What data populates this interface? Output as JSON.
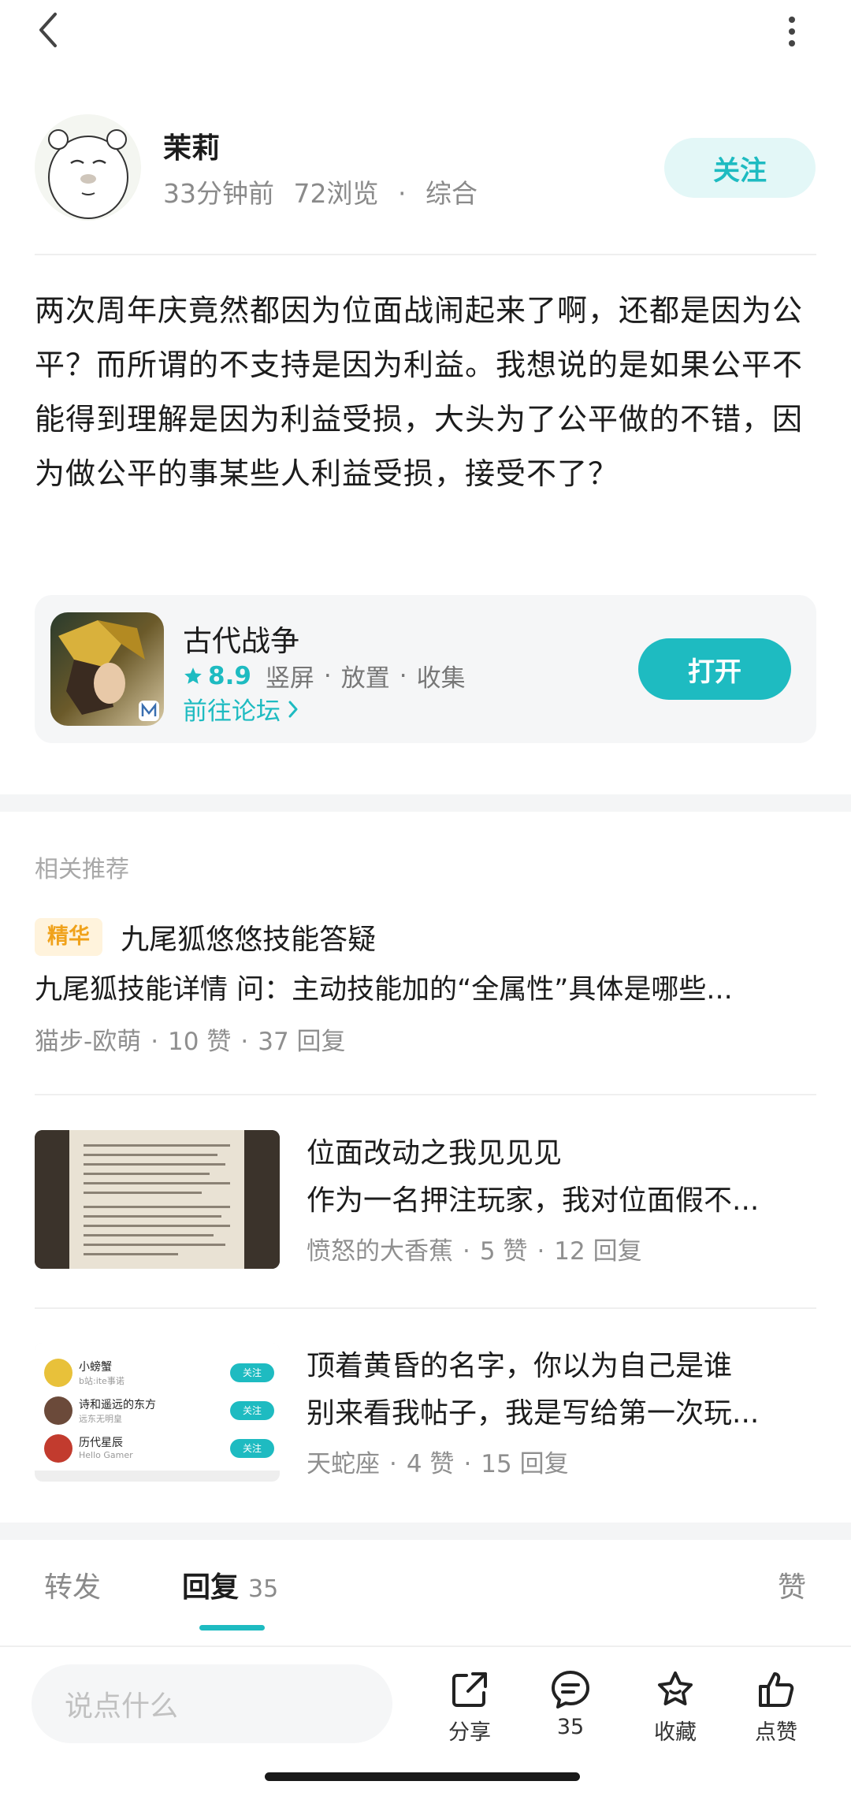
{
  "author": {
    "name": "茉莉",
    "time": "33分钟前",
    "views": "72浏览",
    "category": "综合",
    "follow_label": "关注"
  },
  "post": {
    "body": "两次周年庆竟然都因为位面战闹起来了啊，还都是因为公平？而所谓的不支持是因为利益。我想说的是如果公平不能得到理解是因为利益受损，大头为了公平做的不错，因为做公平的事某些人利益受损，接受不了？"
  },
  "game_card": {
    "name": "古代战争",
    "rating": "8.9",
    "tags": [
      "竖屏",
      "放置",
      "收集"
    ],
    "forum_link": "前往论坛",
    "open_label": "打开"
  },
  "recommend": {
    "section_title": "相关推荐",
    "items": [
      {
        "badge": "精华",
        "title": "九尾狐悠悠技能答疑",
        "subtitle": "九尾狐技能详情 问：主动技能加的“全属性”具体是哪些...",
        "author": "猫步-欧萌",
        "likes": "10 赞",
        "replies": "37 回复"
      },
      {
        "title": "位面改动之我见见见",
        "subtitle": "作为一名押注玩家，我对位面假不...",
        "author": "愤怒的大香蕉",
        "likes": "5 赞",
        "replies": "12 回复"
      },
      {
        "title": "顶着黄昏的名字，你以为自己是谁",
        "subtitle": "别来看我帖子，我是写给第一次玩...",
        "author": "天蛇座",
        "likes": "4 赞",
        "replies": "15 回复",
        "thumb_rows": [
          {
            "name": "小螃蟹",
            "sub": "b站:ite事诺",
            "btn": "关注"
          },
          {
            "name": "诗和遥远的东方",
            "sub": "远东无明皇",
            "btn": "关注"
          },
          {
            "name": "历代星辰",
            "sub": "Hello Gamer",
            "btn": "关注"
          }
        ]
      }
    ]
  },
  "tabs": {
    "repost": "转发",
    "reply": "回复",
    "reply_count": "35",
    "like": "赞"
  },
  "bottom_bar": {
    "placeholder": "说点什么",
    "share": "分享",
    "comments": "35",
    "favorite": "收藏",
    "like": "点赞"
  },
  "colors": {
    "accent": "#1ebbc1",
    "badge_bg": "#fff3dc",
    "badge_text": "#f0a21b"
  }
}
